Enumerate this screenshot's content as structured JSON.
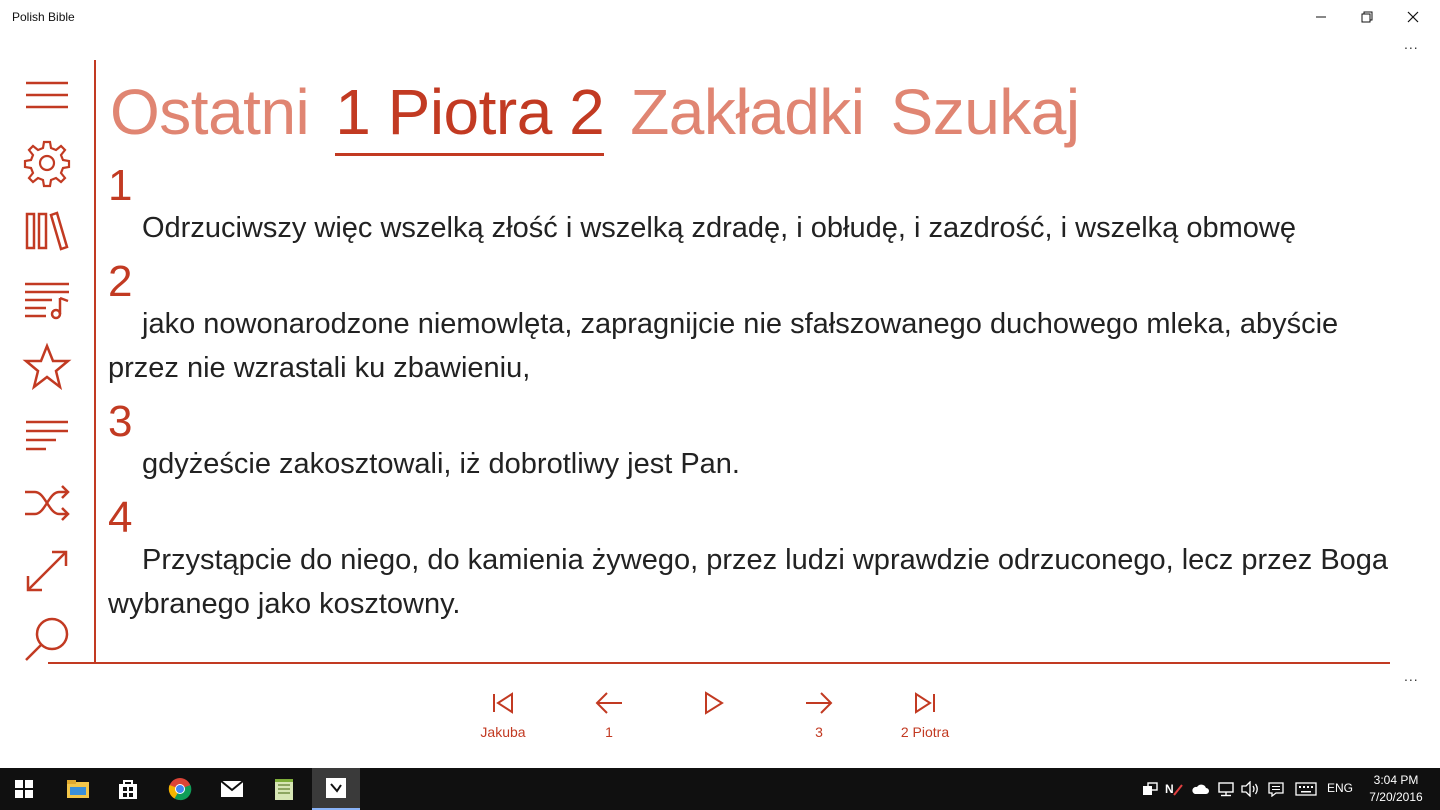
{
  "window": {
    "title": "Polish Bible",
    "minimize_glyph": "—",
    "maximize_glyph": "❐",
    "close_glyph": "✕",
    "more_glyph": "...",
    "more_bottom_glyph": "..."
  },
  "sidebar": {
    "items": [
      {
        "name": "hamburger-menu-icon"
      },
      {
        "name": "settings-gear-icon"
      },
      {
        "name": "library-books-icon"
      },
      {
        "name": "playlist-music-icon"
      },
      {
        "name": "favorite-star-icon"
      },
      {
        "name": "text-align-left-icon"
      },
      {
        "name": "shuffle-icon"
      },
      {
        "name": "expand-diagonal-icon"
      },
      {
        "name": "search-magnifier-icon"
      }
    ]
  },
  "pivot": {
    "tabs": [
      {
        "label": "Ostatni",
        "active": false
      },
      {
        "label": "1 Piotra 2",
        "active": true
      },
      {
        "label": "Zakładki",
        "active": false
      },
      {
        "label": "Szukaj",
        "active": false
      }
    ]
  },
  "verses": [
    {
      "number": "1",
      "text": "Odrzuciwszy więc wszelką złość i wszelką zdradę, i obłudę, i zazdrość, i wszelką obmowę"
    },
    {
      "number": "2",
      "text": "jako nowonarodzone niemowlęta, zapragnijcie nie sfałszowanego duchowego mleka, abyście przez nie wzrastali ku zbawieniu,"
    },
    {
      "number": "3",
      "text": "gdyżeście zakosztowali, iż dobrotliwy jest Pan."
    },
    {
      "number": "4",
      "text": "Przystąpcie do niego, do kamienia żywego, przez ludzi wprawdzie odrzuconego, lecz przez Boga wybranego jako kosztowny."
    }
  ],
  "nav": {
    "first_label": "Jakuba",
    "prev_label": "1",
    "play_label": "",
    "next_label": "3",
    "last_label": "2 Piotra"
  },
  "taskbar": {
    "language": "ENG",
    "time": "3:04 PM",
    "date": "7/20/2016"
  },
  "colors": {
    "accent": "#c23a22",
    "accent_light": "#e08572",
    "taskbar": "#101010"
  }
}
